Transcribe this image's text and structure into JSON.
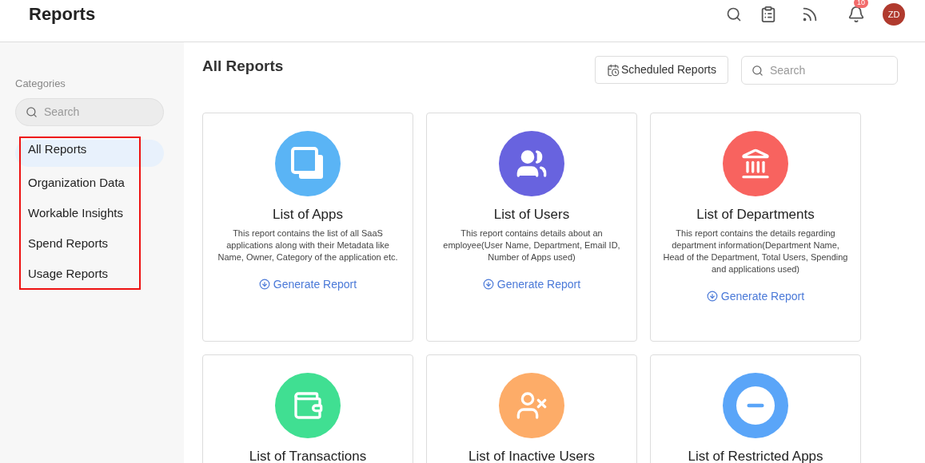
{
  "header": {
    "title": "Reports",
    "notification_count": "10",
    "avatar_initials": "ZD"
  },
  "sidebar": {
    "heading": "Categories",
    "search": {
      "placeholder": "Search"
    },
    "items": [
      {
        "label": "All Reports",
        "selected": true
      },
      {
        "label": "Organization Data",
        "selected": false
      },
      {
        "label": "Workable Insights",
        "selected": false
      },
      {
        "label": "Spend Reports",
        "selected": false
      },
      {
        "label": "Usage Reports",
        "selected": false
      }
    ]
  },
  "main": {
    "title": "All Reports",
    "scheduled_button": "Scheduled Reports",
    "search": {
      "placeholder": "Search"
    },
    "cards": [
      {
        "kind": "apps",
        "color": "#5ab4f5",
        "title": "List of Apps",
        "description": "This report contains the list of all SaaS applications along with their Metadata like Name, Owner, Category of the application etc.",
        "action": "Generate Report"
      },
      {
        "kind": "users",
        "color": "#6863df",
        "title": "List of Users",
        "description": "This report contains details about an employee(User Name, Department, Email ID, Number of Apps used)",
        "action": "Generate Report"
      },
      {
        "kind": "departments",
        "color": "#f8635f",
        "title": "List of Departments",
        "description": "This report contains the details regarding department information(Department Name, Head of the Department, Total Users, Spending and applications used)",
        "action": "Generate Report"
      },
      {
        "kind": "transactions",
        "color": "#40df92",
        "title": "List of Transactions"
      },
      {
        "kind": "inactive",
        "color": "#fdac68",
        "title": "List of Inactive Users"
      },
      {
        "kind": "restricted",
        "color": "#5aa5f8",
        "title": "List of Restricted Apps"
      }
    ]
  }
}
